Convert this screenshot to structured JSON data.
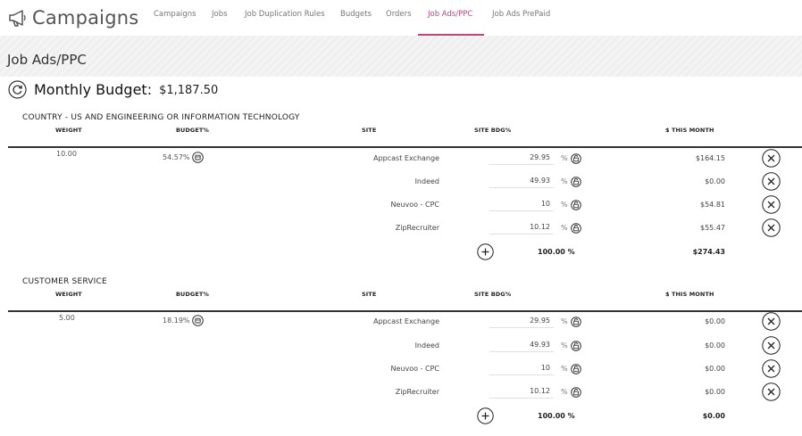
{
  "app": {
    "title": "Campaigns",
    "icon": "megaphone-icon"
  },
  "nav": [
    {
      "label": "Campaigns",
      "active": false
    },
    {
      "label": "Jobs",
      "active": false
    },
    {
      "label": "Job Duplication Rules",
      "active": false
    },
    {
      "label": "Budgets",
      "active": false
    },
    {
      "label": "Orders",
      "active": false
    },
    {
      "label": "Job Ads/PPC",
      "active": true
    },
    {
      "label": "Job Ads PrePaid",
      "active": false
    }
  ],
  "page_title": "Job Ads/PPC",
  "budget": {
    "label": "Monthly Budget:",
    "value": "$1,187.50",
    "icon": "refresh-icon"
  },
  "columns": {
    "weight": "WEIGHT",
    "budget_pct": "BUDGET%",
    "site": "SITE",
    "site_bdg": "SITE BDG%",
    "this_month": "$ THIS MONTH"
  },
  "campaigns": [
    {
      "name": "COUNTRY - US AND ENGINEERING OR INFORMATION TECHNOLOGY",
      "weight": "10.00",
      "budget_pct": "54.57%",
      "sites": [
        {
          "site": "Appcast Exchange",
          "pct": "29.95",
          "amount": "$164.15"
        },
        {
          "site": "Indeed",
          "pct": "49.93",
          "amount": "$0.00"
        },
        {
          "site": "Neuvoo - CPC",
          "pct": "10",
          "amount": "$54.81"
        },
        {
          "site": "ZipRecruiter",
          "pct": "10.12",
          "amount": "$55.47"
        }
      ],
      "total_pct": "100.00 %",
      "total_amount": "$274.43"
    },
    {
      "name": "CUSTOMER SERVICE",
      "weight": "5.00",
      "budget_pct": "18.19%",
      "sites": [
        {
          "site": "Appcast Exchange",
          "pct": "29.95",
          "amount": "$0.00"
        },
        {
          "site": "Indeed",
          "pct": "49.93",
          "amount": "$0.00"
        },
        {
          "site": "Neuvoo - CPC",
          "pct": "10",
          "amount": "$0.00"
        },
        {
          "site": "ZipRecruiter",
          "pct": "10.12",
          "amount": "$0.00"
        }
      ],
      "total_pct": "100.00 %",
      "total_amount": "$0.00"
    }
  ],
  "percent_sign": "%",
  "colors": {
    "accent": "#c0457a",
    "text": "#333333",
    "background": "#f2f2f2"
  }
}
